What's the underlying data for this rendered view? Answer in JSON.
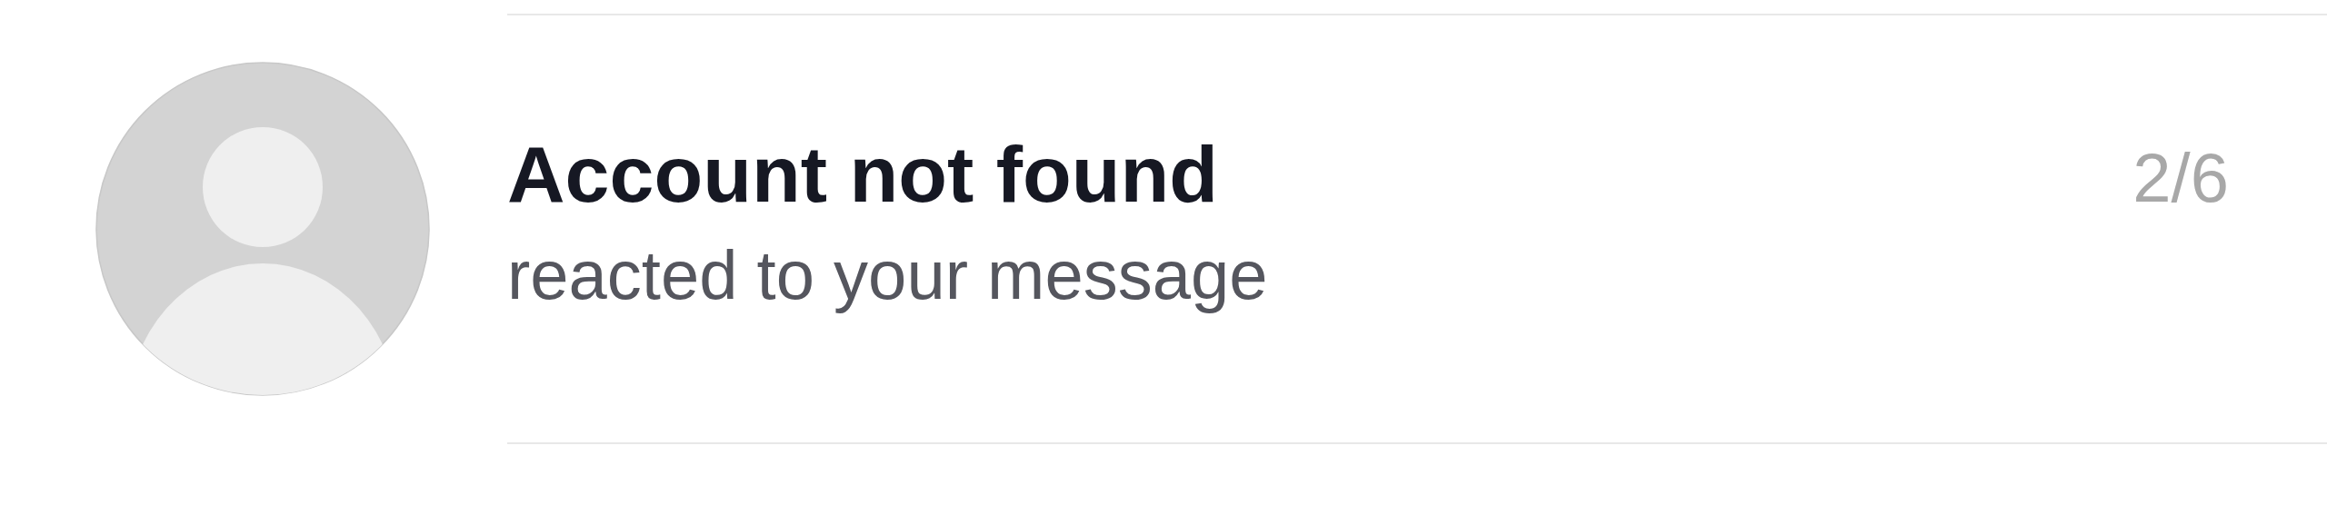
{
  "notification": {
    "avatar": {
      "kind": "placeholder"
    },
    "title": "Account not found",
    "subtitle": "reacted to your message",
    "counter": "2/6"
  }
}
